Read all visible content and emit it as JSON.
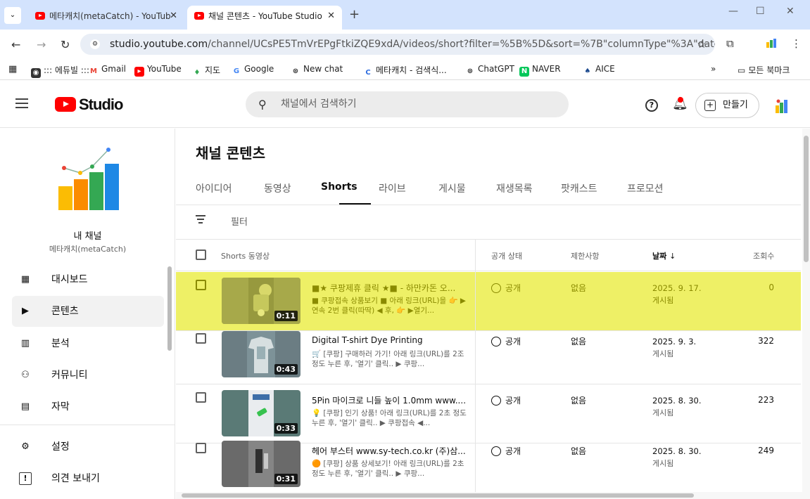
{
  "browser": {
    "tabs": [
      {
        "title": "메타캐치(metaCatch) - YouTub",
        "active": false
      },
      {
        "title": "채널 콘텐츠 - YouTube Studio",
        "active": true
      }
    ],
    "new_tab": "+",
    "url_host": "studio.youtube.com",
    "url_path": "/channel/UCsPE5TmVrEPgFtkiZQE9xdA/videos/short?filter=%5B%5D&sort=%7B\"columnType\"%3A\"date\"%2C\"sortOr...",
    "bookmarks": [
      {
        "label": "::: 에듀빌 :::",
        "icon": "site-icon",
        "color": "#333333"
      },
      {
        "label": "Gmail",
        "icon": "gmail-icon",
        "color": "#ea4335"
      },
      {
        "label": "YouTube",
        "icon": "youtube-icon",
        "color": "#ff0000"
      },
      {
        "label": "지도",
        "icon": "maps-pin-icon",
        "color": "#34a853"
      },
      {
        "label": "Google",
        "icon": "google-icon",
        "color": "#4285f4"
      },
      {
        "label": "New chat",
        "icon": "openai-icon",
        "color": "#333333"
      },
      {
        "label": "메타캐치 - 검색식...",
        "icon": "c-logo-icon",
        "color": "#2d6cdf"
      },
      {
        "label": "ChatGPT",
        "icon": "openai-icon",
        "color": "#333333"
      },
      {
        "label": "NAVER",
        "icon": "naver-icon",
        "color": "#03c75a"
      },
      {
        "label": "AICE",
        "icon": "aice-icon",
        "color": "#1e4b8f"
      }
    ],
    "more_bookmarks": "»",
    "all_bookmarks": "모든 북마크"
  },
  "header": {
    "logo_text": "Studio",
    "search_placeholder": "채널에서 검색하기",
    "create_label": "만들기"
  },
  "sidebar": {
    "channel_title": "내 채널",
    "channel_handle": "메타캐치(metaCatch)",
    "items": [
      {
        "label": "대시보드",
        "icon": "dashboard-icon",
        "glyph": "▦",
        "active": false
      },
      {
        "label": "콘텐츠",
        "icon": "content-icon",
        "glyph": "▶",
        "active": true
      },
      {
        "label": "분석",
        "icon": "analytics-icon",
        "glyph": "▥",
        "active": false
      },
      {
        "label": "커뮤니티",
        "icon": "community-icon",
        "glyph": "⚇",
        "active": false
      },
      {
        "label": "자막",
        "icon": "subtitles-icon",
        "glyph": "▤",
        "active": false
      },
      {
        "label": "설정",
        "icon": "settings-gear-icon",
        "glyph": "⚙",
        "active": false
      },
      {
        "label": "의견 보내기",
        "icon": "feedback-icon",
        "glyph": "!",
        "active": false
      }
    ]
  },
  "main": {
    "page_title": "채널 콘텐츠",
    "tabs": [
      "아이디어",
      "동영상",
      "Shorts",
      "라이브",
      "게시물",
      "재생목록",
      "팟캐스트",
      "프로모션"
    ],
    "active_tab": "Shorts",
    "filter_label": "필터",
    "columns": {
      "video": "Shorts 동영상",
      "visibility": "공개 상태",
      "restrictions": "제한사항",
      "date": "날짜",
      "date_sort": "↓",
      "views": "조회수"
    },
    "rows": [
      {
        "title": "■★ 쿠팡제휴 클릭 ★■ - 하만카돈 오...",
        "desc": "■ 쿠팡접속 상품보기 ■ 아래 링크(URL)을 👉 ▶ 연속 2번 클릭(따딱) ◀ 후, 👉 ▶열기...",
        "duration": "0:11",
        "visibility": "공개",
        "restriction": "없음",
        "date": "2025. 9. 17.",
        "date_status": "게시됨",
        "views": "0",
        "highlight": true,
        "thumb_color": "#8a8a3a"
      },
      {
        "title": "Digital T-shirt Dye Printing",
        "desc": "🛒 [쿠팡] 구매하러 가기! 아래 링크(URL)를 2조 정도 누른 후, '열기' 클릭.. ▶ 쿠팡...",
        "duration": "0:43",
        "visibility": "공개",
        "restriction": "없음",
        "date": "2025. 9. 3.",
        "date_status": "게시됨",
        "views": "322",
        "highlight": false,
        "thumb_color": "#6f7f85"
      },
      {
        "title": "5Pin 마이크로 니들 높이 1.0mm www....",
        "desc": "💡 [쿠팡] 인기 상품! 아래 링크(URL)를 2초 정도 누른 후, '열기' 클릭.. ▶ 쿠팡접속 ◀...",
        "duration": "0:33",
        "visibility": "공개",
        "restriction": "없음",
        "date": "2025. 8. 30.",
        "date_status": "게시됨",
        "views": "223",
        "highlight": false,
        "thumb_color": "#5f7f7a"
      },
      {
        "title": "헤어 부스터 www.sy-tech.co.kr (주)삼...",
        "desc": "🟠 [쿠팡] 상품 상세보기! 아래 링크(URL)를 2초 정도 누른 후, '열기' 클릭.. ▶ 쿠팡...",
        "duration": "0:31",
        "visibility": "공개",
        "restriction": "없음",
        "date": "2025. 8. 30.",
        "date_status": "게시됨",
        "views": "249",
        "highlight": false,
        "thumb_color": "#6a6a6a"
      }
    ]
  }
}
